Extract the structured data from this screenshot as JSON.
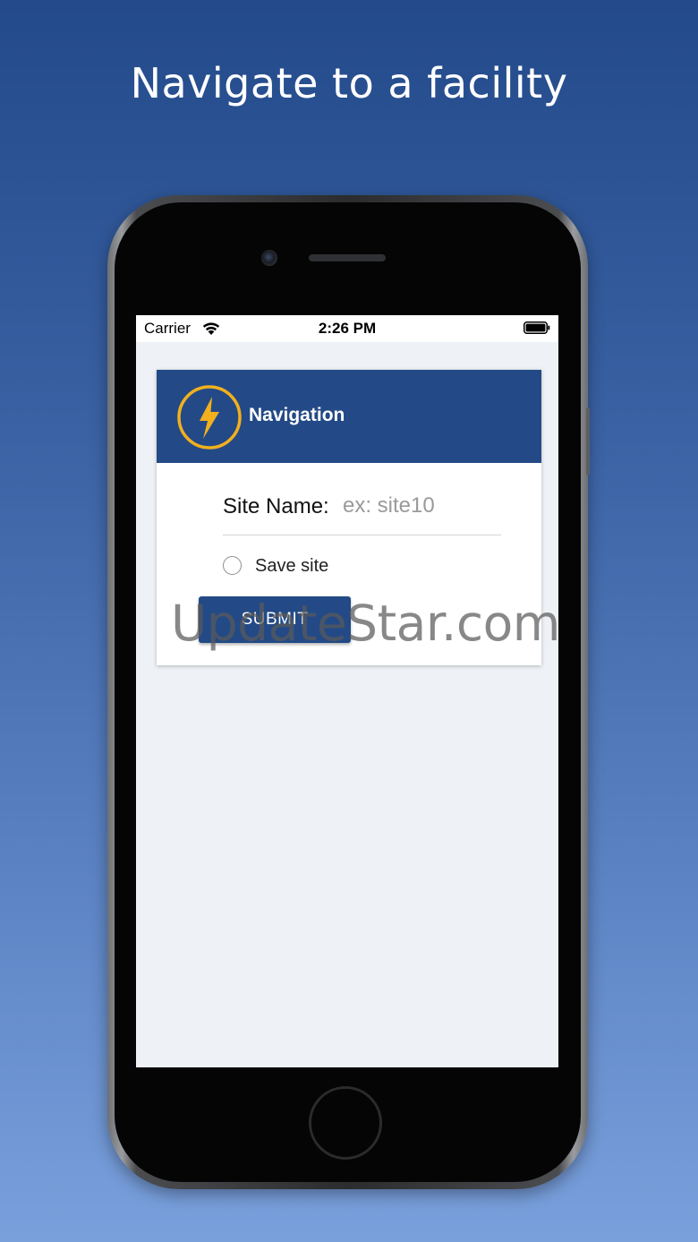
{
  "promo": {
    "heading": "Navigate to a facility"
  },
  "status_bar": {
    "carrier": "Carrier",
    "time": "2:26 PM",
    "icons": [
      "wifi-icon",
      "battery-icon"
    ]
  },
  "card": {
    "title": "Navigation",
    "logo_icon": "lightning-bolt-icon",
    "site_name_label": "Site Name:",
    "site_name_value": "",
    "site_name_placeholder": "ex: site10",
    "save_site_label": "Save site",
    "save_site_checked": false,
    "submit_label": "SUBMIT"
  },
  "watermark": "UpdateStar.com",
  "colors": {
    "header": "#234a86",
    "accent": "#f2b01e",
    "background_top": "#234a8a",
    "background_bottom": "#7aa0dc"
  }
}
